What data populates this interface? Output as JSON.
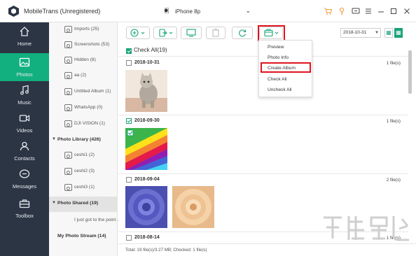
{
  "app": {
    "title": "MobileTrans (Unregistered)"
  },
  "device": {
    "name": "iPhone 8p"
  },
  "titlebar_icons": [
    "cart-icon",
    "key-icon",
    "feedback-icon",
    "menu-icon",
    "minimize-icon",
    "maximize-icon",
    "close-icon"
  ],
  "nav": [
    {
      "label": "Home",
      "icon": "home-icon",
      "active": false
    },
    {
      "label": "Photos",
      "icon": "photos-icon",
      "active": true
    },
    {
      "label": "Music",
      "icon": "music-icon",
      "active": false
    },
    {
      "label": "Videos",
      "icon": "videos-icon",
      "active": false
    },
    {
      "label": "Contacts",
      "icon": "contacts-icon",
      "active": false
    },
    {
      "label": "Messages",
      "icon": "messages-icon",
      "active": false
    },
    {
      "label": "Toolbox",
      "icon": "toolbox-icon",
      "active": false
    }
  ],
  "albums": {
    "camera_roll_items": [
      "Imports (25)",
      "Screenshots (53)",
      "Hidden (8)",
      "aa (2)",
      "Untitled Album (1)",
      "WhatsApp (0)",
      "DJI VISION (1)"
    ],
    "photo_library": "Photo Library (426)",
    "library_items": [
      "ceshi1 (2)",
      "ceshi2 (3)",
      "ceshi3 (1)"
    ],
    "photo_shared": "Photo Shared (19)",
    "shared_items": [
      "I just got to the point ..."
    ],
    "photo_stream": "My Photo Stream (14)"
  },
  "toolbar": {
    "date_value": "2018-10-31"
  },
  "content": {
    "check_all": "Check All(19)",
    "groups": [
      {
        "date": "2018-10-31",
        "files": "1 file(s)",
        "checked": false
      },
      {
        "date": "2018-09-30",
        "files": "1 file(s)",
        "checked": true
      },
      {
        "date": "2018-09-04",
        "files": "2 file(s)",
        "checked": false
      },
      {
        "date": "2018-08-14",
        "files": "1 file(s)",
        "checked": false
      }
    ],
    "status": "Total: 19 file(s)/3.27 MB; Checked: 1 file(s)"
  },
  "menu": {
    "items": [
      "Preview",
      "Photo Info",
      "Create Album",
      "Check All",
      "Uncheck All"
    ]
  },
  "colors": {
    "accent": "#1aa37a",
    "nav_bg": "#2b3544",
    "highlight": "#e0141e",
    "orange": "#f19a3a"
  }
}
